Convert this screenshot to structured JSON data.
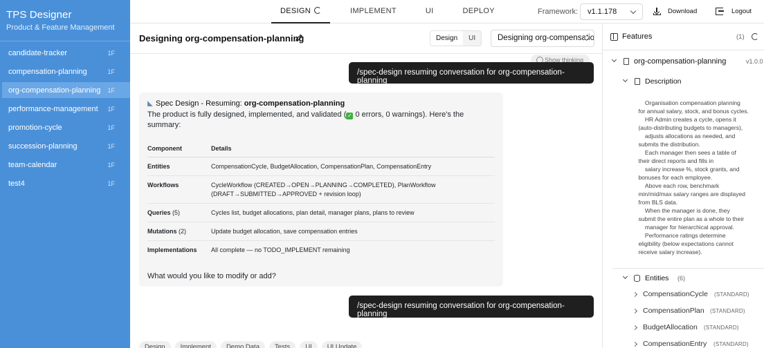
{
  "app": {
    "title": "TPS Designer",
    "subtitle": "Product & Feature Management"
  },
  "sidebar": {
    "items": [
      {
        "label": "candidate-tracker",
        "count": "1F"
      },
      {
        "label": "compensation-planning",
        "count": "1F"
      },
      {
        "label": "org-compensation-planning",
        "count": "1F",
        "active": true
      },
      {
        "label": "performance-management",
        "count": "1F"
      },
      {
        "label": "promotion-cycle",
        "count": "1F"
      },
      {
        "label": "succession-planning",
        "count": "1F"
      },
      {
        "label": "team-calendar",
        "count": "1F"
      },
      {
        "label": "test4",
        "count": "1F"
      }
    ]
  },
  "topbar": {
    "tabs": [
      "DESIGN",
      "IMPLEMENT",
      "UI",
      "DEPLOY"
    ],
    "framework_label": "Framework:",
    "framework_value": "v1.1.178",
    "download_label": "Download",
    "logout_label": "Logout"
  },
  "main": {
    "title": "Designing org-compensation-planning",
    "mode_design": "Design",
    "mode_ui": "UI",
    "conversation_select": "Designing org-compensation-planning"
  },
  "chat": {
    "show_thinking": "Show thinking",
    "user_message_1": "/spec-design resuming conversation for org-compensation-planning",
    "user_message_2": "/spec-design resuming conversation for org-compensation-planning",
    "assistant": {
      "heading_prefix": "Spec Design - Resuming: ",
      "heading_name": "org-compensation-planning",
      "intro_1": "The product is fully designed, implemented, and validated (",
      "intro_check": "✓",
      "intro_2": " 0 errors, 0 warnings). Here's the summary:",
      "table_headers": [
        "Component",
        "Details"
      ],
      "rows": [
        {
          "component": "Entities",
          "count": "",
          "details": "CompensationCycle, BudgetAllocation, CompensationPlan, CompensationEntry"
        },
        {
          "component": "Workflows",
          "count": "",
          "details": "CycleWorkflow (CREATED→OPEN→PLANNING→COMPLETED), PlanWorkflow (DRAFT→SUBMITTED→APPROVED + revision loop)"
        },
        {
          "component": "Queries",
          "count": "(5)",
          "details": "Cycles list, budget allocations, plan detail, manager plans, plans to review"
        },
        {
          "component": "Mutations",
          "count": "(2)",
          "details": "Update budget allocation, save compensation entries"
        },
        {
          "component": "Implementations",
          "count": "",
          "details": "All complete — no TODO_IMPLEMENT remaining"
        }
      ],
      "closing": "What would you like to modify or add?"
    },
    "chips": [
      "Design",
      "Implement",
      "Demo Data",
      "Tests",
      "UI",
      "UI Update"
    ]
  },
  "features": {
    "title": "Features",
    "count": "(1)",
    "feature_name": "org-compensation-planning",
    "feature_version": "v1.0.0",
    "description_label": "Description",
    "description_text": "        Organisation compensation planning\n    for annual salary, stock, and bonus cycles.\n        HR Admin creates a cycle, opens it\n    (auto-distributing budgets to managers),\n        adjusts allocations as needed, and\n    submits the distribution.\n        Each manager then sees a table of\n    their direct reports and fills in\n        salary increase %, stock grants, and\n    bonuses for each employee.\n        Above each row, benchmark\n    min/mid/max salary ranges are displayed\n    from BLS data.\n        When the manager is done, they\n    submit the entire plan as a whole to their\n        manager for hierarchical approval.\n        Performance ratings determine\n    eligibility (below expectations cannot\n    receive salary increase).",
    "entities_label": "Entities",
    "entities_count": "(6)",
    "entities": [
      {
        "name": "CompensationCycle",
        "type": "(STANDARD)"
      },
      {
        "name": "CompensationPlan",
        "type": "(STANDARD)"
      },
      {
        "name": "BudgetAllocation",
        "type": "(STANDARD)"
      },
      {
        "name": "CompensationEntry",
        "type": "(STANDARD)"
      }
    ]
  }
}
